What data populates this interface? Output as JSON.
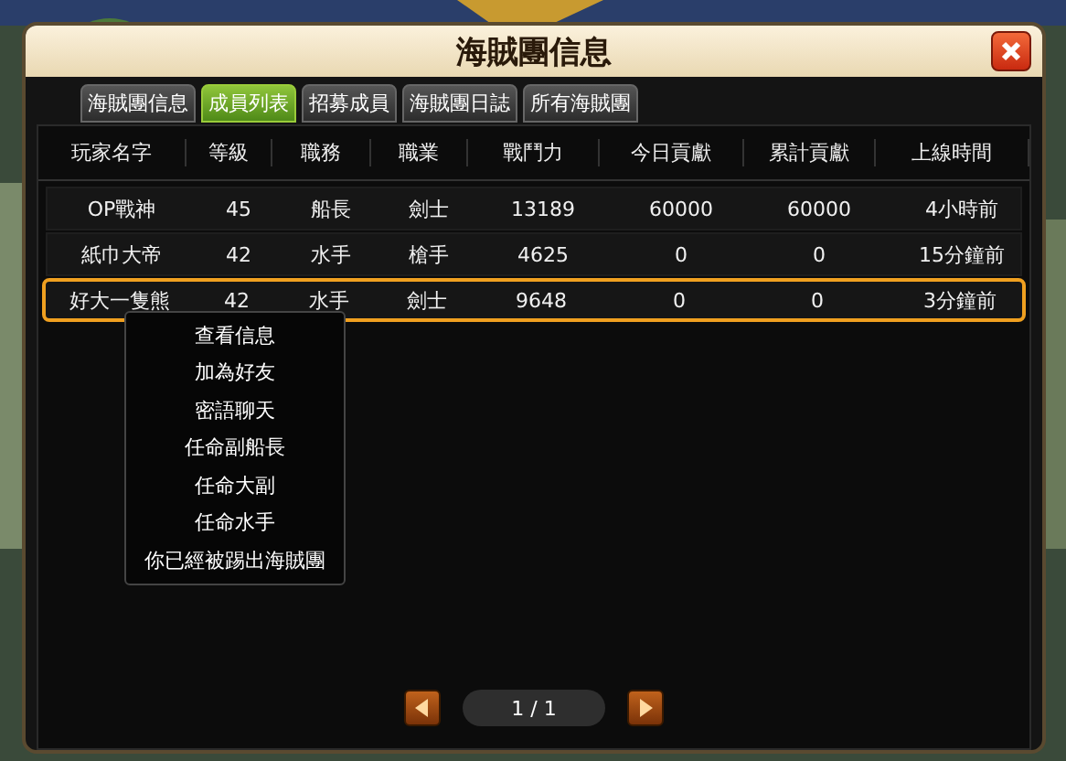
{
  "window": {
    "title": "海賊團信息"
  },
  "tabs": [
    {
      "label": "海賊團信息",
      "selected": false
    },
    {
      "label": "成員列表",
      "selected": true
    },
    {
      "label": "招募成員",
      "selected": false
    },
    {
      "label": "海賊團日誌",
      "selected": false
    },
    {
      "label": "所有海賊團",
      "selected": false
    }
  ],
  "table": {
    "columns": [
      "玩家名字",
      "等級",
      "職務",
      "職業",
      "戰鬥力",
      "今日貢獻",
      "累計貢獻",
      "上線時間"
    ],
    "rows": [
      {
        "selected": false,
        "cells": [
          "OP戰神",
          "45",
          "船長",
          "劍士",
          "13189",
          "60000",
          "60000",
          "4小時前"
        ]
      },
      {
        "selected": false,
        "cells": [
          "紙巾大帝",
          "42",
          "水手",
          "槍手",
          "4625",
          "0",
          "0",
          "15分鐘前"
        ]
      },
      {
        "selected": true,
        "cells": [
          "好大一隻熊",
          "42",
          "水手",
          "劍士",
          "9648",
          "0",
          "0",
          "3分鐘前"
        ]
      }
    ]
  },
  "context_menu": {
    "items": [
      "查看信息",
      "加為好友",
      "密語聊天",
      "任命副船長",
      "任命大副",
      "任命水手",
      "你已經被踢出海賊團"
    ]
  },
  "pager": {
    "page": "1 / 1"
  }
}
